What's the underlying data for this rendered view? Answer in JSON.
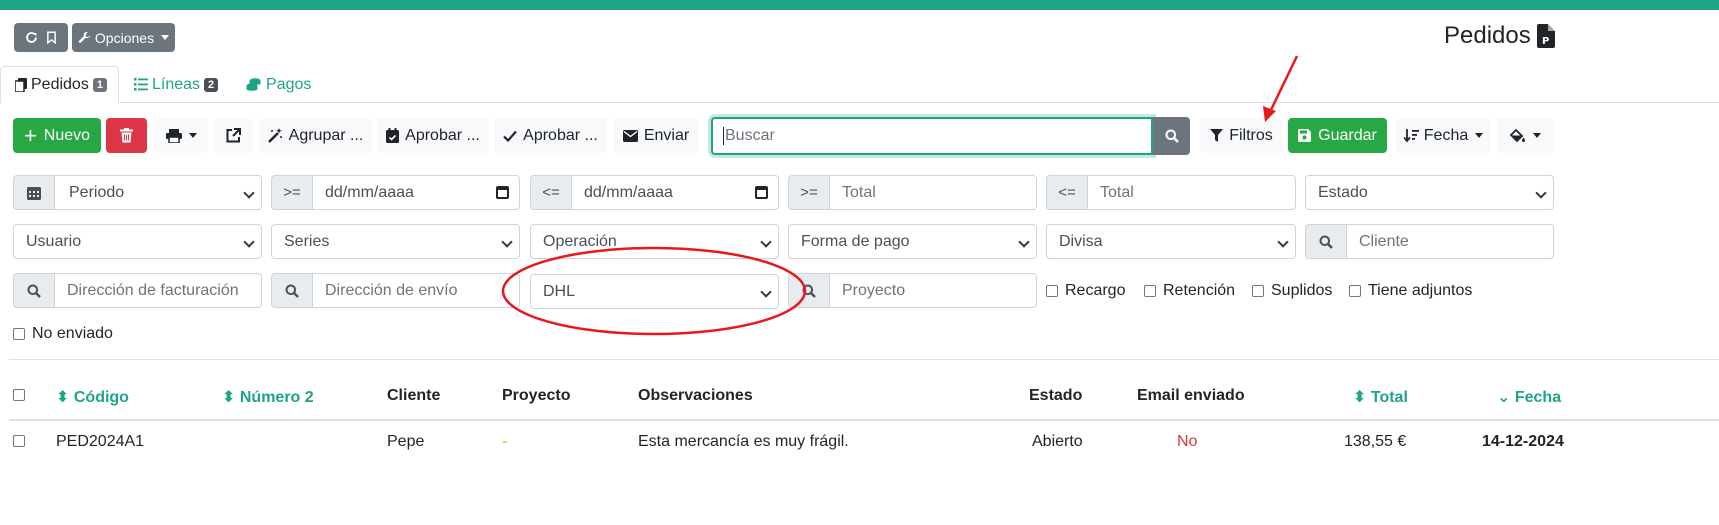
{
  "colors": {
    "accent": "#20a487",
    "green": "#28a745",
    "red": "#dc3545",
    "annotation": "#e8191c"
  },
  "toolbar_top": {
    "options_label": "Opciones"
  },
  "page": {
    "title": "Pedidos"
  },
  "tabs": [
    {
      "label": "Pedidos",
      "badge": "1"
    },
    {
      "label": "Líneas",
      "badge": "2"
    },
    {
      "label": "Pagos"
    }
  ],
  "actions": {
    "new_label": "Nuevo",
    "group_label": "Agrupar ...",
    "approve1_label": "Aprobar ...",
    "approve2_label": "Aprobar ...",
    "send_label": "Enviar",
    "search_placeholder": "Buscar",
    "filters_label": "Filtros",
    "save_label": "Guardar",
    "order_label": "Fecha"
  },
  "filters": {
    "period": "Periodo",
    "gte": ">=",
    "lte": "<=",
    "date_placeholder": "dd/mm/aaaa",
    "total_placeholder": "Total",
    "status": "Estado",
    "user": "Usuario",
    "series": "Series",
    "operation": "Operación",
    "payment": "Forma de pago",
    "currency": "Divisa",
    "client_placeholder": "Cliente",
    "billing_address_placeholder": "Dirección de facturación",
    "shipping_address_placeholder": "Dirección de envío",
    "carrier": "DHL",
    "project_placeholder": "Proyecto",
    "surcharge": "Recargo",
    "retention": "Retención",
    "supplied": "Suplidos",
    "attachments": "Tiene adjuntos",
    "not_sent": "No enviado"
  },
  "table": {
    "headers": {
      "code": "Código",
      "number2": "Número 2",
      "client": "Cliente",
      "project": "Proyecto",
      "observations": "Observaciones",
      "status": "Estado",
      "email_sent": "Email enviado",
      "total": "Total",
      "date": "Fecha"
    },
    "rows": [
      {
        "code": "PED2024A1",
        "number2": "",
        "client": "Pepe",
        "project": "-",
        "observations": "Esta mercancía es muy frágil.",
        "status": "Abierto",
        "email_sent": "No",
        "total": "138,55 €",
        "date": "14-12-2024"
      }
    ]
  }
}
